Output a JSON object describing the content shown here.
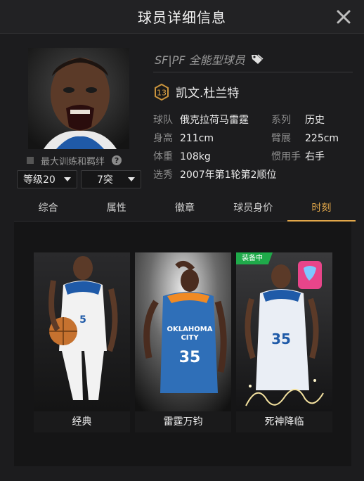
{
  "header": {
    "title": "球员详细信息"
  },
  "player": {
    "role": "SF|PF 全能型球员",
    "level_badge": "13",
    "name": "凯文.杜兰特",
    "info": [
      {
        "k": "球队",
        "v": "俄克拉荷马雷霆"
      },
      {
        "k": "系列",
        "v": "历史"
      },
      {
        "k": "身高",
        "v": "211cm"
      },
      {
        "k": "臂展",
        "v": "225cm"
      },
      {
        "k": "体重",
        "v": "108kg"
      },
      {
        "k": "惯用手",
        "v": "右手"
      },
      {
        "k": "选秀",
        "v": "2007年第1轮第2顺位"
      }
    ]
  },
  "training": {
    "label": "最大训练和羁绊",
    "help": "?"
  },
  "selects": {
    "level": "等级20",
    "breakthrough": "7突"
  },
  "tabs": [
    {
      "label": "综合"
    },
    {
      "label": "属性"
    },
    {
      "label": "徽章"
    },
    {
      "label": "球员身价"
    },
    {
      "label": "时刻"
    }
  ],
  "moments": [
    {
      "label": "经典",
      "jersey": "5"
    },
    {
      "label": "雷霆万钧",
      "jersey": "35"
    },
    {
      "label": "死神降临",
      "jersey": "35",
      "badge": "装备中"
    }
  ],
  "colors": {
    "accent": "#e3a84a",
    "equipped": "#1faa4a"
  },
  "icons": {
    "close": "close-icon",
    "tag": "tag-icon",
    "help": "help-icon"
  }
}
